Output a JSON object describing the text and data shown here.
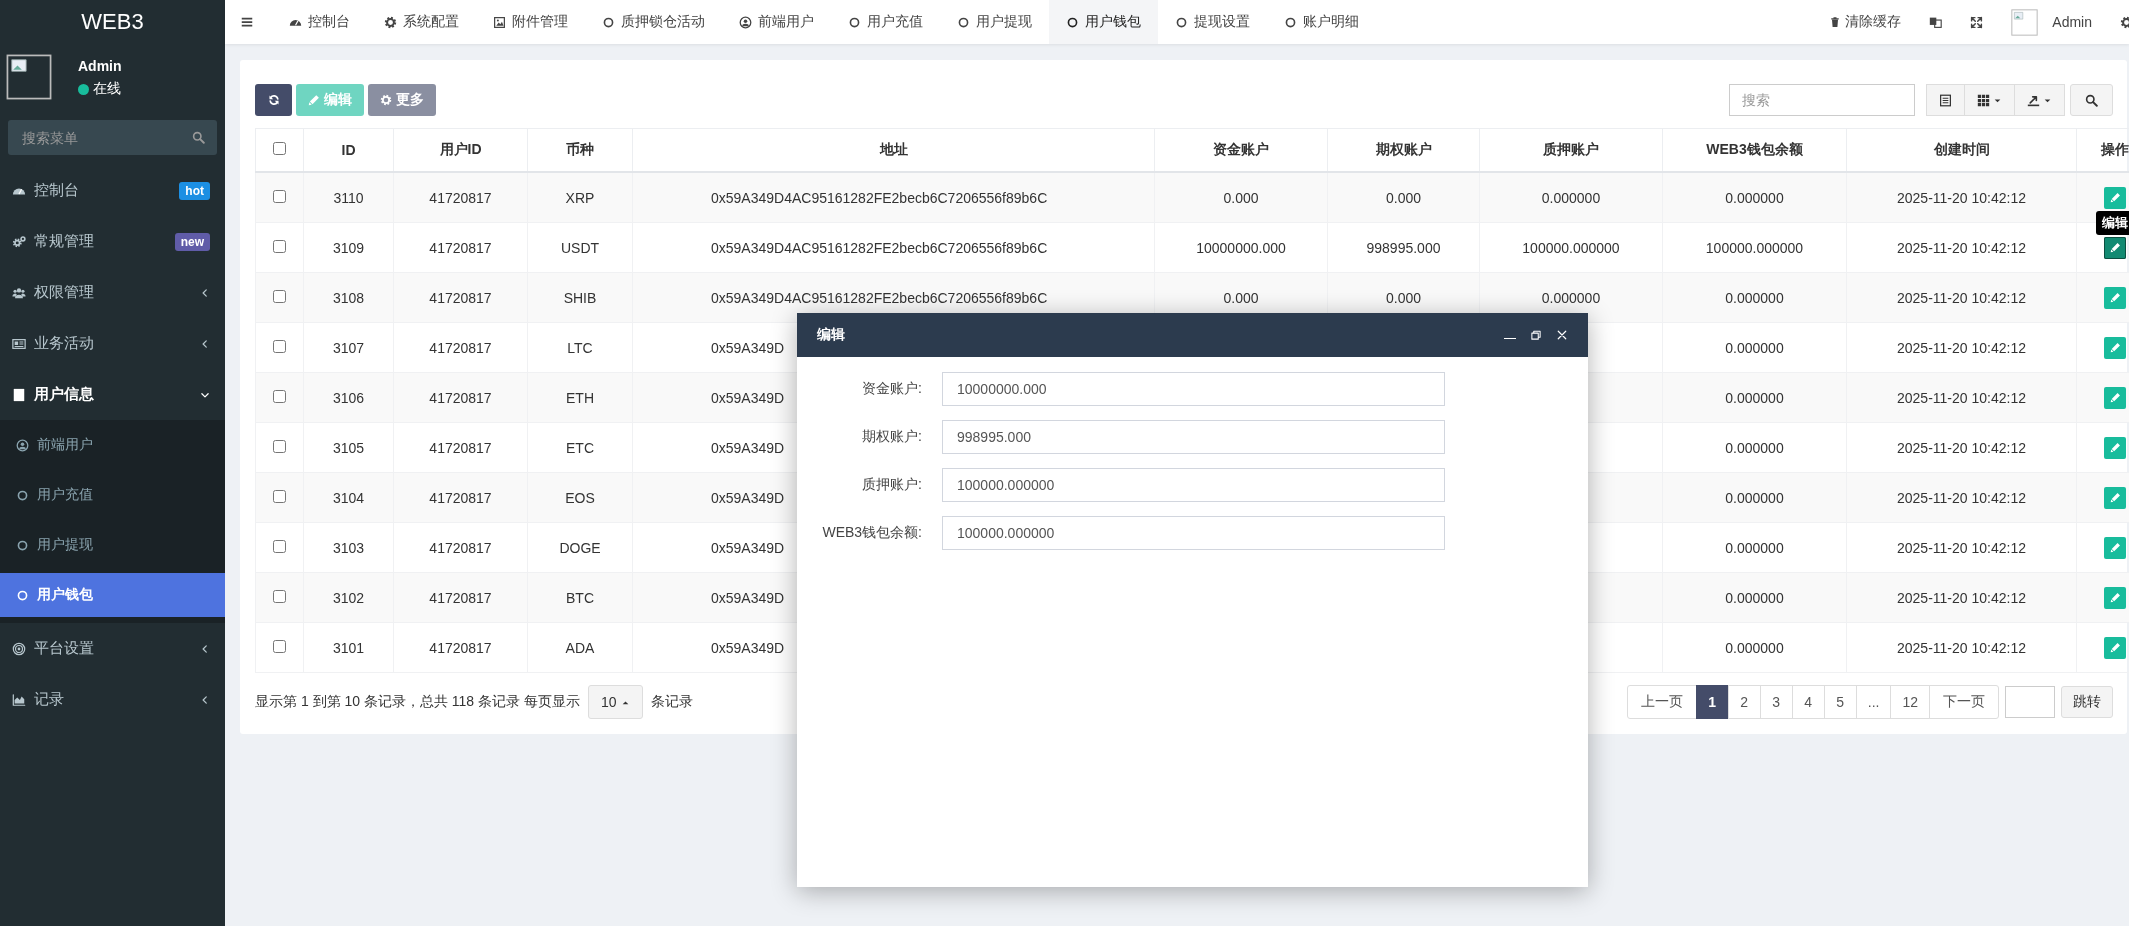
{
  "sidebar": {
    "logo": "WEB3",
    "user": {
      "name": "Admin",
      "status": "在线",
      "online": true
    },
    "search": {
      "placeholder": "搜索菜单"
    },
    "items": [
      {
        "label": "控制台",
        "kind": "dashboard",
        "badge": {
          "text": "hot",
          "color": "#1c8fe3"
        }
      },
      {
        "label": "常规管理",
        "kind": "gears",
        "badge": {
          "text": "new",
          "color": "#605ca8"
        }
      },
      {
        "label": "权限管理",
        "kind": "users",
        "expanded": false
      },
      {
        "label": "业务活动",
        "kind": "news",
        "expanded": false
      },
      {
        "label": "用户信息",
        "kind": "contact",
        "expanded": true,
        "children": [
          {
            "label": "前端用户",
            "kind": "user",
            "selected": false
          },
          {
            "label": "用户充值",
            "kind": "circle",
            "selected": false
          },
          {
            "label": "用户提现",
            "kind": "circle",
            "selected": false
          },
          {
            "label": "用户钱包",
            "kind": "circle",
            "selected": true
          }
        ]
      },
      {
        "label": "平台设置",
        "kind": "target",
        "expanded": false
      },
      {
        "label": "记录",
        "kind": "chart",
        "expanded": false
      }
    ]
  },
  "topnav": {
    "items": [
      {
        "label": "控制台",
        "kind": "dashboard",
        "selected": false
      },
      {
        "label": "系统配置",
        "kind": "gear",
        "selected": false
      },
      {
        "label": "附件管理",
        "kind": "image",
        "selected": false
      },
      {
        "label": "质押锁仓活动",
        "kind": "circle",
        "selected": false
      },
      {
        "label": "前端用户",
        "kind": "user",
        "selected": false
      },
      {
        "label": "用户充值",
        "kind": "circle",
        "selected": false
      },
      {
        "label": "用户提现",
        "kind": "circle",
        "selected": false
      },
      {
        "label": "用户钱包",
        "kind": "circle",
        "selected": true
      },
      {
        "label": "提现设置",
        "kind": "circle",
        "selected": false
      },
      {
        "label": "账户明细",
        "kind": "circle",
        "selected": false
      }
    ],
    "clear_cache": "清除缓存",
    "user": "Admin"
  },
  "toolbar": {
    "buttons": [
      {
        "kind": "refresh",
        "disabled": false
      },
      {
        "kind": "edit",
        "label": "编辑",
        "disabled": true
      },
      {
        "kind": "more",
        "label": "更多",
        "disabled": true
      }
    ],
    "search": {
      "placeholder": "搜索"
    }
  },
  "table": {
    "header_checked": false,
    "columns": [
      "ID",
      "用户ID",
      "币种",
      "地址",
      "资金账户",
      "期权账户",
      "质押账户",
      "WEB3钱包余额",
      "创建时间",
      "操作"
    ],
    "action_tooltip": "编辑",
    "rows": [
      {
        "checked": false,
        "hovered": false,
        "id": "3110",
        "user_id": "41720817",
        "coin": "XRP",
        "address": "0x59A349D4AC95161282FE2becb6C7206556f89b6C",
        "fund": "0.000",
        "option": "0.000",
        "pledge": "0.000000",
        "wallet": "0.000000",
        "created": "2025-11-20 10:42:12"
      },
      {
        "checked": false,
        "hovered": true,
        "id": "3109",
        "user_id": "41720817",
        "coin": "USDT",
        "address": "0x59A349D4AC95161282FE2becb6C7206556f89b6C",
        "fund": "10000000.000",
        "option": "998995.000",
        "pledge": "100000.000000",
        "wallet": "100000.000000",
        "created": "2025-11-20 10:42:12"
      },
      {
        "checked": false,
        "hovered": false,
        "id": "3108",
        "user_id": "41720817",
        "coin": "SHIB",
        "address": "0x59A349D4AC95161282FE2becb6C7206556f89b6C",
        "fund": "0.000",
        "option": "0.000",
        "pledge": "0.000000",
        "wallet": "0.000000",
        "created": "2025-11-20 10:42:12"
      },
      {
        "checked": false,
        "hovered": false,
        "id": "3107",
        "user_id": "41720817",
        "coin": "LTC",
        "address": "0x59A349D",
        "wallet": "0.000000",
        "created": "2025-11-20 10:42:12"
      },
      {
        "checked": false,
        "hovered": false,
        "id": "3106",
        "user_id": "41720817",
        "coin": "ETH",
        "address": "0x59A349D",
        "wallet": "0.000000",
        "created": "2025-11-20 10:42:12"
      },
      {
        "checked": false,
        "hovered": false,
        "id": "3105",
        "user_id": "41720817",
        "coin": "ETC",
        "address": "0x59A349D",
        "wallet": "0.000000",
        "created": "2025-11-20 10:42:12"
      },
      {
        "checked": false,
        "hovered": false,
        "id": "3104",
        "user_id": "41720817",
        "coin": "EOS",
        "address": "0x59A349D",
        "wallet": "0.000000",
        "created": "2025-11-20 10:42:12"
      },
      {
        "checked": false,
        "hovered": false,
        "id": "3103",
        "user_id": "41720817",
        "coin": "DOGE",
        "address": "0x59A349D",
        "wallet": "0.000000",
        "created": "2025-11-20 10:42:12"
      },
      {
        "checked": false,
        "hovered": false,
        "id": "3102",
        "user_id": "41720817",
        "coin": "BTC",
        "address": "0x59A349D",
        "wallet": "0.000000",
        "created": "2025-11-20 10:42:12"
      },
      {
        "checked": false,
        "hovered": false,
        "id": "3101",
        "user_id": "41720817",
        "coin": "ADA",
        "address": "0x59A349D",
        "wallet": "0.000000",
        "created": "2025-11-20 10:42:12"
      }
    ]
  },
  "pagination": {
    "summary": "显示第 1 到第 10 条记录，总共 118 条记录 每页显示",
    "page_size": "10",
    "suffix": "条记录",
    "prev": "上一页",
    "pages": [
      {
        "label": "1",
        "selected": true
      },
      {
        "label": "2",
        "selected": false
      },
      {
        "label": "3",
        "selected": false
      },
      {
        "label": "4",
        "selected": false
      },
      {
        "label": "5",
        "selected": false
      },
      {
        "label": "...",
        "selected": false
      },
      {
        "label": "12",
        "selected": false
      }
    ],
    "next": "下一页",
    "jump": "跳转"
  },
  "modal": {
    "title": "编辑",
    "fields": [
      {
        "label": "资金账户:",
        "value": "10000000.000"
      },
      {
        "label": "期权账户:",
        "value": "998995.000"
      },
      {
        "label": "质押账户:",
        "value": "100000.000000"
      },
      {
        "label": "WEB3钱包余额:",
        "value": "100000.000000"
      }
    ]
  }
}
